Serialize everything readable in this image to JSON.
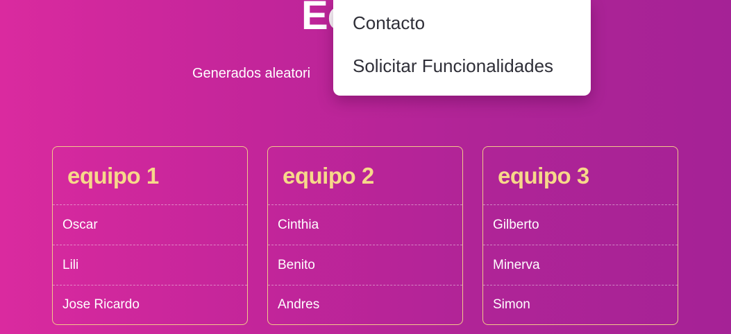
{
  "header": {
    "title": "Ec",
    "subtitle": "Generados aleatori"
  },
  "dropdown_menu": {
    "items": [
      {
        "label": "Contacto"
      },
      {
        "label": "Solicitar Funcionalidades"
      }
    ]
  },
  "teams": [
    {
      "title": "equipo 1",
      "members": [
        "Oscar",
        "Lili",
        "Jose Ricardo"
      ]
    },
    {
      "title": "equipo 2",
      "members": [
        "Cinthia",
        "Benito",
        "Andres"
      ]
    },
    {
      "title": "equipo 3",
      "members": [
        "Gilberto",
        "Minerva",
        "Simon"
      ]
    }
  ],
  "colors": {
    "background_start": "#da2a9f",
    "background_end": "#a52296",
    "team_title": "#f7d88a",
    "card_border": "#f2c98a",
    "menu_background": "#ffffff",
    "menu_text": "#2f2f38"
  }
}
